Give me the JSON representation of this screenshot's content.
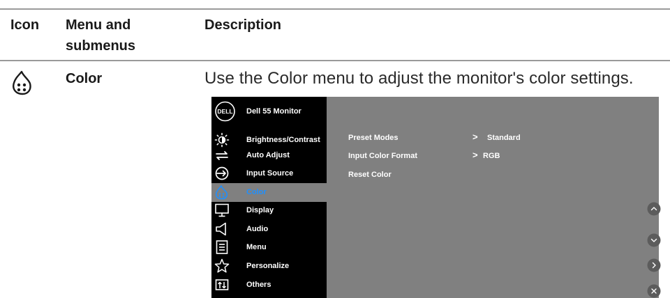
{
  "table": {
    "headers": {
      "icon": "Icon",
      "menu": "Menu and",
      "menu_line2": "submenus",
      "description": "Description"
    },
    "row": {
      "title": "Color",
      "icon": "color-palette-icon",
      "description": "Use the Color menu to adjust the monitor's color settings."
    }
  },
  "osd": {
    "title": "Dell 55 Monitor",
    "logo_text": "DELL",
    "menu_items": [
      {
        "label": "Brightness/Contrast",
        "icon": "brightness-icon",
        "active": false
      },
      {
        "label": "Auto Adjust",
        "icon": "auto-adjust-icon",
        "active": false
      },
      {
        "label": "Input Source",
        "icon": "input-source-icon",
        "active": false
      },
      {
        "label": "Color",
        "icon": "color-icon",
        "active": true
      },
      {
        "label": "Display",
        "icon": "display-icon",
        "active": false
      },
      {
        "label": "Audio",
        "icon": "audio-icon",
        "active": false
      },
      {
        "label": "Menu",
        "icon": "menu-icon",
        "active": false
      },
      {
        "label": "Personalize",
        "icon": "star-icon",
        "active": false
      },
      {
        "label": "Others",
        "icon": "others-icon",
        "active": false
      }
    ],
    "options": [
      {
        "label": "Preset Modes",
        "arrow": ">",
        "value": "Standard"
      },
      {
        "label": "Input Color Format",
        "arrow": ">",
        "value": "RGB"
      },
      {
        "label": "Reset Color",
        "arrow": "",
        "value": ""
      }
    ],
    "nav_buttons": [
      "up-button-icon",
      "down-button-icon",
      "right-button-icon",
      "exit-button-icon"
    ],
    "active_color": "#1e90ff",
    "panel_color": "#808080"
  }
}
